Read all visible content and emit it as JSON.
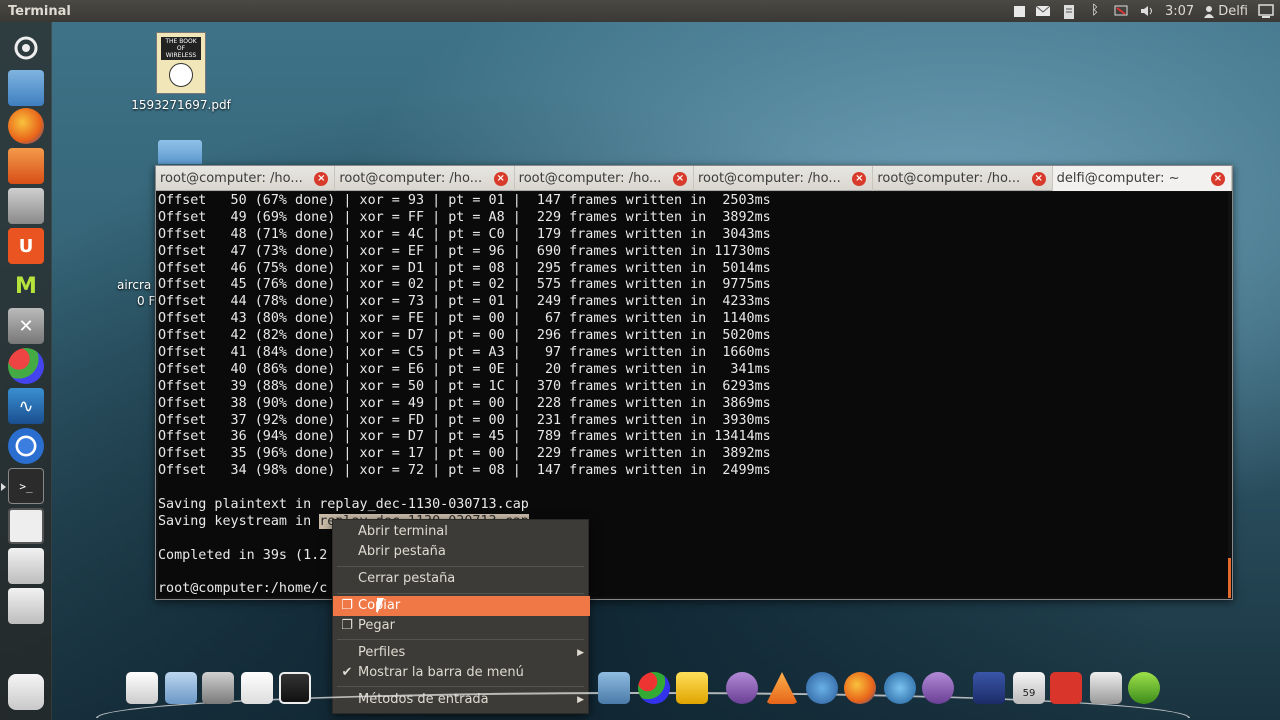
{
  "top_panel": {
    "app_title": "Terminal",
    "clock": "3:07",
    "user": "Delfi"
  },
  "desktop": {
    "pdf": {
      "label": "1593271697.pdf",
      "cover_title": "THE BOOK OF WIRELESS"
    },
    "partial_label_1": "aircra",
    "partial_label_2": "0 F"
  },
  "terminal": {
    "tabs": [
      {
        "label": "root@computer: /ho..."
      },
      {
        "label": "root@computer: /ho..."
      },
      {
        "label": "root@computer: /ho..."
      },
      {
        "label": "root@computer: /ho..."
      },
      {
        "label": "root@computer: /ho..."
      },
      {
        "label": "delfi@computer: ~"
      }
    ],
    "lines": [
      "Offset   50 (67% done) | xor = 93 | pt = 01 |  147 frames written in  2503ms",
      "Offset   49 (69% done) | xor = FF | pt = A8 |  229 frames written in  3892ms",
      "Offset   48 (71% done) | xor = 4C | pt = C0 |  179 frames written in  3043ms",
      "Offset   47 (73% done) | xor = EF | pt = 96 |  690 frames written in 11730ms",
      "Offset   46 (75% done) | xor = D1 | pt = 08 |  295 frames written in  5014ms",
      "Offset   45 (76% done) | xor = 02 | pt = 02 |  575 frames written in  9775ms",
      "Offset   44 (78% done) | xor = 73 | pt = 01 |  249 frames written in  4233ms",
      "Offset   43 (80% done) | xor = FE | pt = 00 |   67 frames written in  1140ms",
      "Offset   42 (82% done) | xor = D7 | pt = 00 |  296 frames written in  5020ms",
      "Offset   41 (84% done) | xor = C5 | pt = A3 |   97 frames written in  1660ms",
      "Offset   40 (86% done) | xor = E6 | pt = 0E |   20 frames written in   341ms",
      "Offset   39 (88% done) | xor = 50 | pt = 1C |  370 frames written in  6293ms",
      "Offset   38 (90% done) | xor = 49 | pt = 00 |  228 frames written in  3869ms",
      "Offset   37 (92% done) | xor = FD | pt = 00 |  231 frames written in  3930ms",
      "Offset   36 (94% done) | xor = D7 | pt = 45 |  789 frames written in 13414ms",
      "Offset   35 (96% done) | xor = 17 | pt = 00 |  229 frames written in  3892ms",
      "Offset   34 (98% done) | xor = 72 | pt = 08 |  147 frames written in  2499ms",
      "",
      "Saving plaintext in replay_dec-1130-030713.cap",
      "Saving keystream in ",
      "",
      "Completed in 39s (1.2",
      "",
      "root@computer:/home/c"
    ],
    "selected_fragment": "replay_dec-1130-030713.cap"
  },
  "context_menu": {
    "items": [
      {
        "label": "Abrir terminal"
      },
      {
        "label": "Abrir pestaña"
      },
      {
        "label": "Cerrar pestaña"
      },
      {
        "label": "Copiar"
      },
      {
        "label": "Pegar"
      },
      {
        "label": "Perfiles"
      },
      {
        "label": "Mostrar la barra de menú"
      },
      {
        "label": "Métodos de entrada"
      }
    ]
  },
  "dock": {
    "badge": "59"
  },
  "colors": {
    "menu_highlight": "#f07746",
    "tab_close": "#d83b2b",
    "panel_bg": "#3c3b37"
  }
}
